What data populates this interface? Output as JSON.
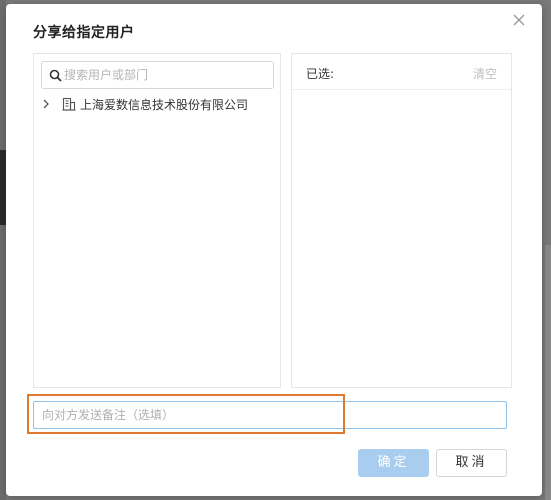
{
  "dialog": {
    "title": "分享给指定用户",
    "close_icon": "close-icon"
  },
  "left_panel": {
    "search": {
      "placeholder": "搜索用户或部门",
      "value": "",
      "icon": "search-icon"
    },
    "tree": [
      {
        "label": "上海爱数信息技术股份有限公司",
        "expand_icon": "chevron-right-icon",
        "icon": "building-icon",
        "expanded": false
      }
    ]
  },
  "right_panel": {
    "selected_label": "已选:",
    "clear_label": "清空",
    "items": []
  },
  "note": {
    "placeholder": "向对方发送备注（选填）",
    "value": ""
  },
  "buttons": {
    "ok_label": "确定",
    "cancel_label": "取消"
  },
  "colors": {
    "ok_button": "#a9cdef",
    "note_border": "#90c4ea",
    "highlight": "#e07a2e"
  }
}
